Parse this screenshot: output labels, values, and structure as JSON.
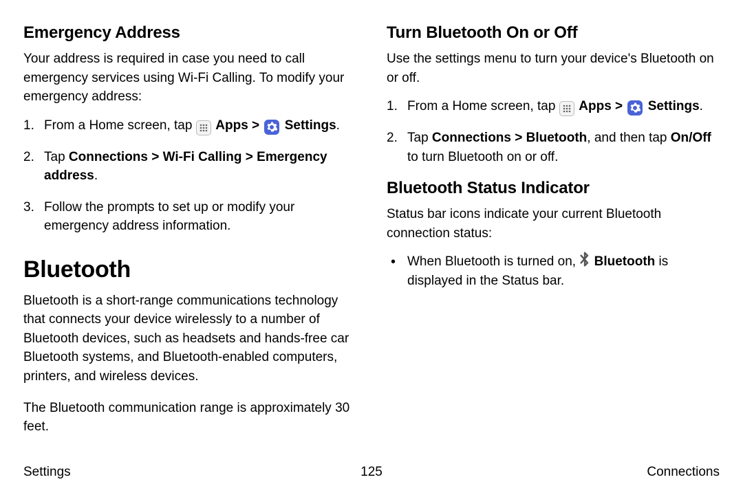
{
  "left": {
    "h2_emergency": "Emergency Address",
    "emergency_intro": "Your address is required in case you need to call emergency services using Wi‑Fi Calling. To modify your emergency address:",
    "step1_a": "From a Home screen, tap ",
    "apps_word": " Apps",
    "chevron": " > ",
    "settings_word": " Settings",
    "period": ".",
    "step2_a": "Tap ",
    "step2_b": "Connections > Wi‑Fi Calling > Emergency address",
    "step3": "Follow the prompts to set up or modify your emergency address information.",
    "h1_bluetooth": "Bluetooth",
    "bt_para1": "Bluetooth is a short-range communications technology that connects your device wirelessly to a number of Bluetooth devices, such as headsets and hands-free car Bluetooth systems, and Bluetooth-enabled computers, printers, and wireless devices.",
    "bt_para2": "The Bluetooth communication range is approximately 30 feet."
  },
  "right": {
    "h2_turn": "Turn Bluetooth On or Off",
    "turn_intro": "Use the settings menu to turn your device's Bluetooth on or off.",
    "r_step1_a": "From a Home screen, tap ",
    "r_step2_a": "Tap ",
    "r_step2_b": "Connections > Bluetooth",
    "r_step2_c": ", and then tap ",
    "r_step2_d": "On/Off",
    "r_step2_e": " to turn Bluetooth on or off.",
    "h2_status": "Bluetooth Status Indicator",
    "status_intro": "Status bar icons indicate your current Bluetooth connection status:",
    "bullet_a": "When Bluetooth is turned on, ",
    "bullet_b": " Bluetooth",
    "bullet_c": " is displayed in the Status bar."
  },
  "footer": {
    "left": "Settings",
    "center": "125",
    "right": "Connections"
  }
}
